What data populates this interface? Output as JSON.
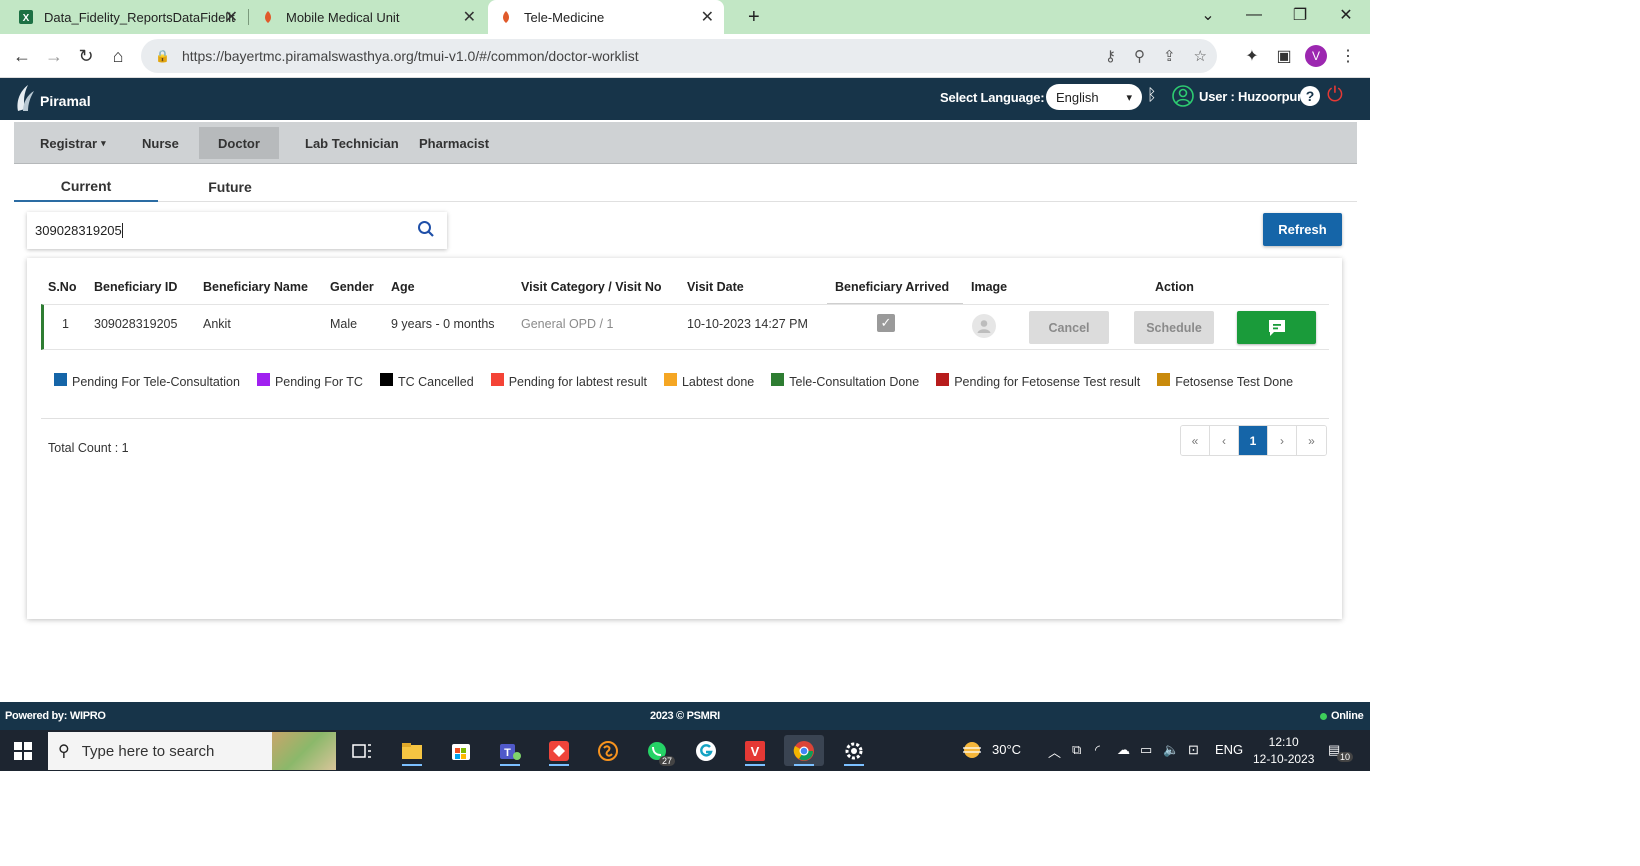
{
  "browser": {
    "tabs": [
      {
        "title": "Data_Fidelity_ReportsDataFidelit",
        "icon": "excel-icon"
      },
      {
        "title": "Mobile Medical Unit",
        "icon": "piramal-icon"
      },
      {
        "title": "Tele-Medicine",
        "icon": "piramal-icon",
        "active": true
      }
    ],
    "url": "https://bayertmc.piramalswasthya.org/tmui-v1.0/#/common/doctor-worklist",
    "profile_initial": "V"
  },
  "header": {
    "brand": "Piramal",
    "language_label": "Select Language:",
    "language_value": "English",
    "user_label": "User : Huzoorpur",
    "help": "?"
  },
  "roles": {
    "items": [
      "Registrar",
      "Nurse",
      "Doctor",
      "Lab Technician",
      "Pharmacist"
    ],
    "active": "Doctor"
  },
  "worklist_tabs": {
    "current": "Current",
    "future": "Future"
  },
  "search": {
    "value": "309028319205"
  },
  "refresh_label": "Refresh",
  "table": {
    "headers": {
      "sno": "S.No",
      "beneficiary_id": "Beneficiary ID",
      "beneficiary_name": "Beneficiary Name",
      "gender": "Gender",
      "age": "Age",
      "visit_category": "Visit Category / Visit No",
      "visit_date": "Visit Date",
      "arrived": "Beneficiary Arrived",
      "image": "Image",
      "action": "Action"
    },
    "rows": [
      {
        "sno": "1",
        "beneficiary_id": "309028319205",
        "beneficiary_name": "Ankit",
        "gender": "Male",
        "age": "9 years - 0 months",
        "visit_category": "General OPD / 1",
        "visit_date": "10-10-2023 14:27 PM",
        "arrived": true,
        "cancel_label": "Cancel",
        "schedule_label": "Schedule"
      }
    ]
  },
  "legend": [
    {
      "label": "Pending For Tele-Consultation",
      "color": "#1565a8"
    },
    {
      "label": "Pending For TC",
      "color": "#a020f0"
    },
    {
      "label": "TC Cancelled",
      "color": "#000000"
    },
    {
      "label": "Pending for labtest result",
      "color": "#f44336"
    },
    {
      "label": "Labtest done",
      "color": "#f5a623"
    },
    {
      "label": "Tele-Consultation Done",
      "color": "#2e7d32"
    },
    {
      "label": "Pending for Fetosense Test result",
      "color": "#b71c1c"
    },
    {
      "label": "Fetosense Test Done",
      "color": "#c98a0c"
    }
  ],
  "total_count": "Total Count : 1",
  "pagination": {
    "first": "«",
    "prev": "‹",
    "current": "1",
    "next": "›",
    "last": "»"
  },
  "footer": {
    "powered": "Powered by: WIPRO",
    "copyright": "2023 © PSMRI",
    "status": "Online"
  },
  "taskbar": {
    "search_placeholder": "Type here to search",
    "weather": "30°C",
    "lang": "ENG",
    "time": "12:10",
    "date": "12-10-2023",
    "whatsapp_badge": "27",
    "notif_badge": "10"
  }
}
